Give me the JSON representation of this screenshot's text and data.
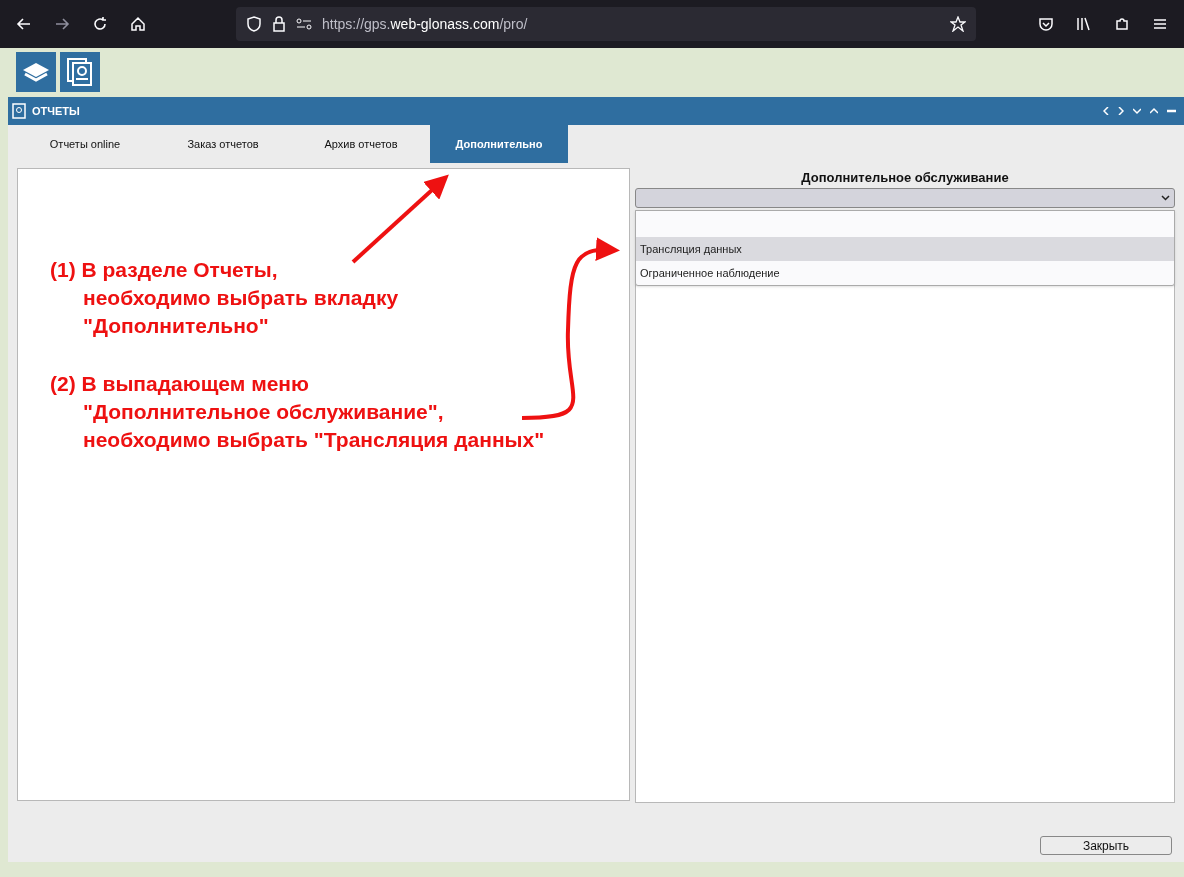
{
  "browser": {
    "url_prefix": "https://gps.",
    "url_domain": "web-glonass.com",
    "url_path": "/pro/"
  },
  "window": {
    "title": "ОТЧЕТЫ"
  },
  "tabs": [
    {
      "label": "Отчеты online",
      "selected": false
    },
    {
      "label": "Заказ отчетов",
      "selected": false
    },
    {
      "label": "Архив отчетов",
      "selected": false
    },
    {
      "label": "Дополнительно",
      "selected": true
    }
  ],
  "service_panel": {
    "title": "Дополнительное обслуживание",
    "dropdown": {
      "expanded": true,
      "options": [
        {
          "label": "Трансляция данных",
          "selected": true
        },
        {
          "label": "Ограниченное наблюдение",
          "selected": false
        }
      ]
    }
  },
  "annotations": [
    {
      "lines": [
        "(1) В разделе Отчеты,",
        "необходимо выбрать вкладку",
        "\"Дополнительно\""
      ]
    },
    {
      "lines": [
        "(2) В выпадающем меню",
        "\"Дополнительное обслуживание\",",
        "необходимо выбрать \"Трансляция данных\""
      ]
    }
  ],
  "buttons": [
    {
      "label": "Закрыть"
    }
  ]
}
